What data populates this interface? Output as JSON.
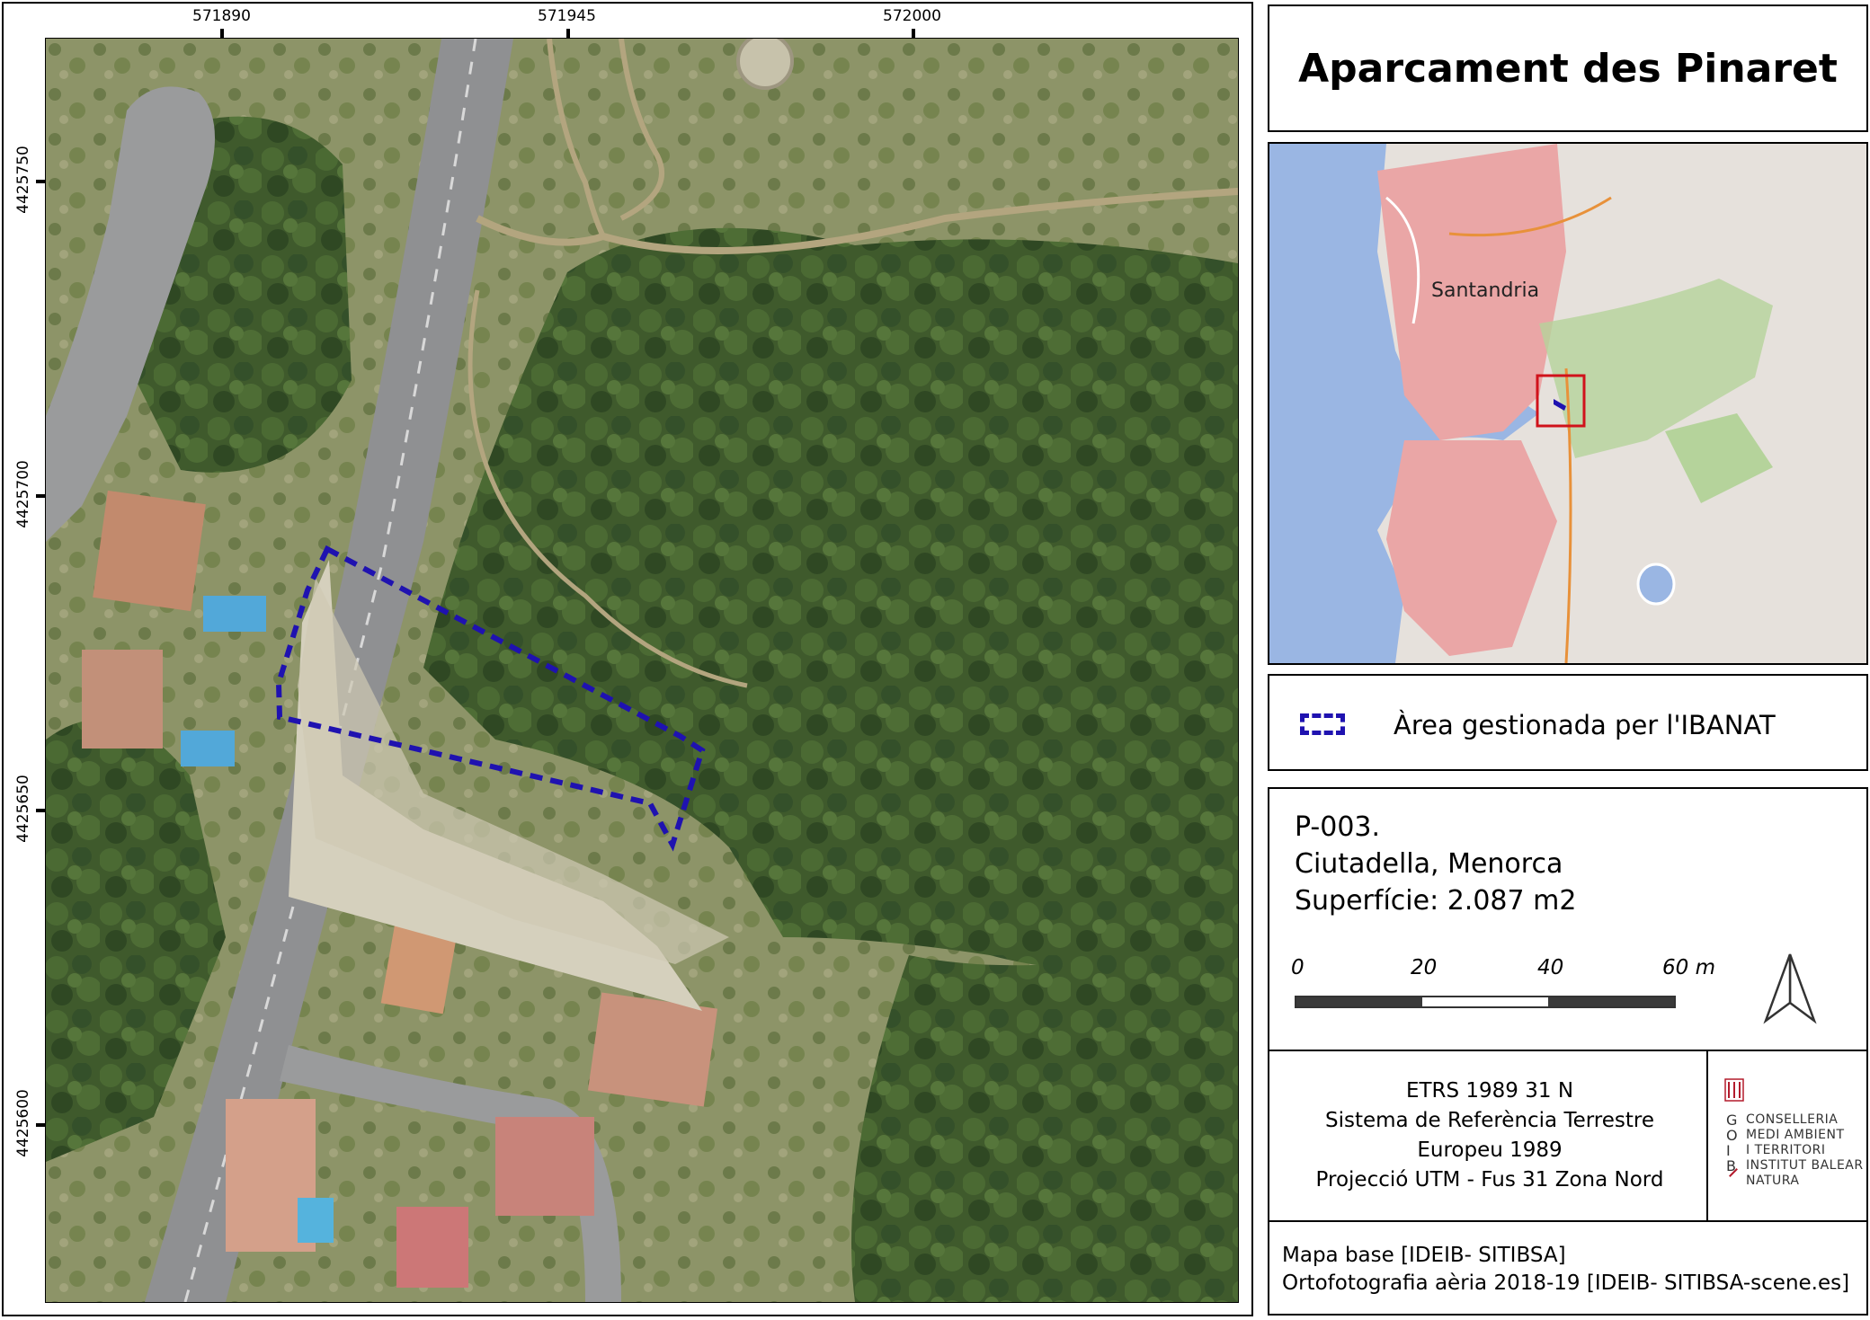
{
  "title": "Aparcament des Pinaret",
  "map_grid": {
    "x_labels": [
      "571890",
      "571945",
      "572000"
    ],
    "y_labels": [
      "4425750",
      "4425700",
      "4425650",
      "4425600"
    ]
  },
  "legend": {
    "label": "Àrea gestionada per l'IBANAT",
    "color": "#1f12b0"
  },
  "inset_map": {
    "place_label": "Santandria"
  },
  "info": {
    "code": "P-003.",
    "location": "Ciutadella, Menorca",
    "area": "Superfície: 2.087 m2"
  },
  "scale_bar": {
    "labels": [
      "0",
      "20",
      "40",
      "60 m"
    ]
  },
  "crs": {
    "line1": "ETRS 1989 31 N",
    "line2": "Sistema de Referència Terrestre",
    "line3": "Europeu 1989",
    "line4": "Projecció UTM - Fus 31 Zona Nord"
  },
  "logo": {
    "letters": [
      "G",
      "O",
      "I",
      "B"
    ],
    "lines": [
      "CONSELLERIA",
      "MEDI AMBIENT",
      "I TERRITORI",
      "INSTITUT BALEAR",
      "NATURA"
    ]
  },
  "sources": {
    "line1": "Mapa base [IDEIB- SITIBSA]",
    "line2": "Ortofotografia aèria 2018-19 [IDEIB- SITIBSA-scene.es]"
  },
  "colors": {
    "accent": "#1f12b0",
    "inset_box": "#d0121b"
  }
}
